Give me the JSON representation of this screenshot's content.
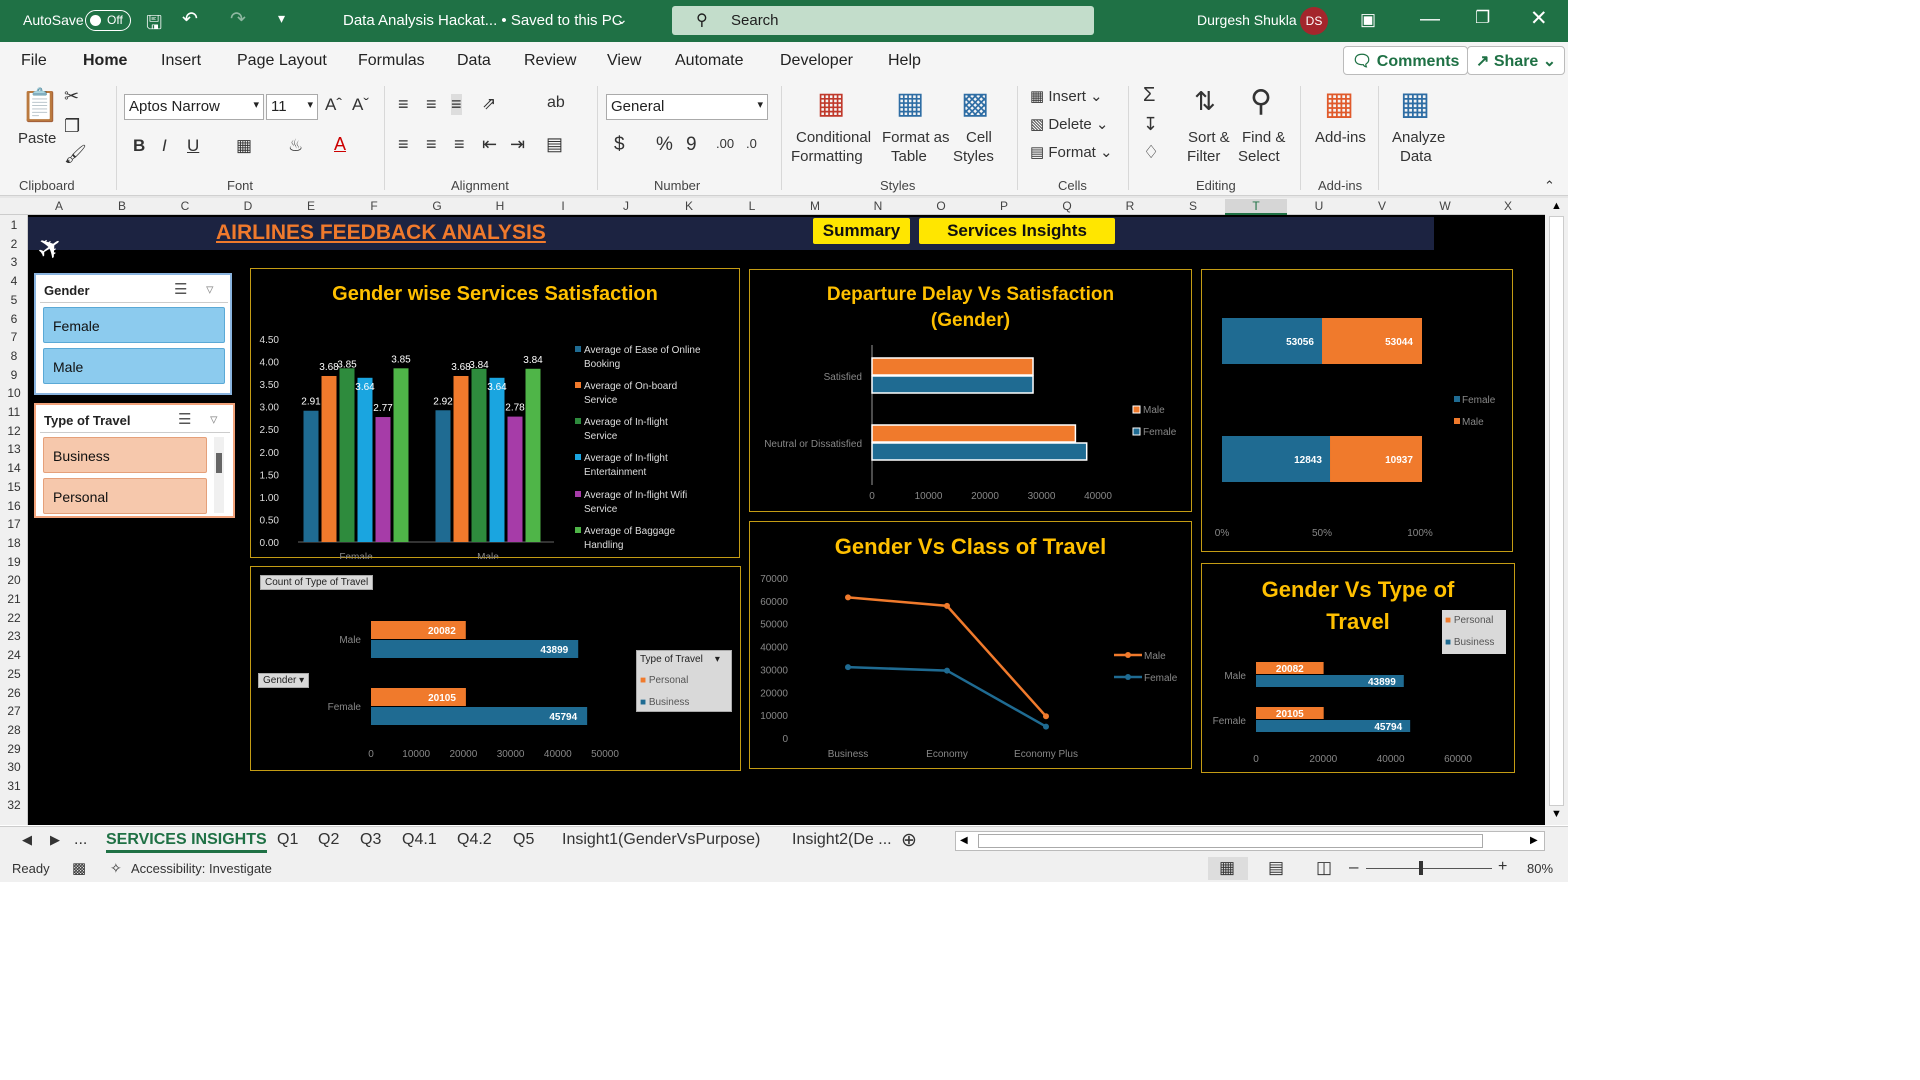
{
  "titlebar": {
    "autosave_label": "AutoSave",
    "autosave_state": "Off",
    "doc_title": "Data Analysis Hackat... • Saved to this PC",
    "search_placeholder": "Search",
    "user_name": "Durgesh Shukla",
    "user_initials": "DS"
  },
  "menu": {
    "items": [
      "File",
      "Home",
      "Insert",
      "Page Layout",
      "Formulas",
      "Data",
      "Review",
      "View",
      "Automate",
      "Developer",
      "Help"
    ],
    "active": "Home",
    "comments_label": "Comments",
    "share_label": "Share"
  },
  "ribbon": {
    "paste_label": "Paste",
    "font_name": "Aptos Narrow",
    "font_size": "11",
    "number_format": "General",
    "conditional_formatting": [
      "Conditional",
      "Formatting"
    ],
    "format_as_table": [
      "Format as",
      "Table"
    ],
    "cell_styles": [
      "Cell",
      "Styles"
    ],
    "insert_label": "Insert",
    "delete_label": "Delete",
    "format_label": "Format",
    "sort_filter": [
      "Sort &",
      "Filter"
    ],
    "find_select": [
      "Find &",
      "Select"
    ],
    "addins_label": "Add-ins",
    "analyze_data": [
      "Analyze",
      "Data"
    ],
    "groups": [
      "Clipboard",
      "Font",
      "Alignment",
      "Number",
      "Styles",
      "Cells",
      "Editing",
      "Add-ins"
    ]
  },
  "grid": {
    "columns": [
      "A",
      "B",
      "C",
      "D",
      "E",
      "F",
      "G",
      "H",
      "I",
      "J",
      "K",
      "L",
      "M",
      "N",
      "O",
      "P",
      "Q",
      "R",
      "S",
      "T",
      "U",
      "V",
      "W",
      "X"
    ],
    "rows": [
      "1",
      "2",
      "3",
      "4",
      "5",
      "6",
      "7",
      "8",
      "9",
      "10",
      "11",
      "12",
      "13",
      "14",
      "15",
      "16",
      "17",
      "18",
      "19",
      "20",
      "21",
      "22",
      "23",
      "24",
      "25",
      "26",
      "27",
      "28",
      "29",
      "30",
      "31",
      "32"
    ]
  },
  "dashboard": {
    "title": "AIRLINES FEEDBACK ANALYSIS",
    "summary_button": "Summary",
    "services_button": "Services Insights",
    "accent_color": "#ffc000",
    "orange": "#f07a2c",
    "blue": "#1f6b92"
  },
  "slicers": {
    "gender": {
      "title": "Gender",
      "items": [
        "Female",
        "Male"
      ]
    },
    "travel": {
      "title": "Type of Travel",
      "items": [
        "Business",
        "Personal"
      ]
    }
  },
  "chart_data": [
    {
      "type": "bar",
      "title": "Gender wise Services Satisfaction",
      "categories": [
        "Female",
        "Male"
      ],
      "ylim": [
        0,
        4.5
      ],
      "yticks": [
        "0.00",
        "0.50",
        "1.00",
        "1.50",
        "2.00",
        "2.50",
        "3.00",
        "3.50",
        "4.00",
        "4.50"
      ],
      "series": [
        {
          "name": "Average of Ease of Online Booking",
          "color": "#1f6b92",
          "values": [
            2.91,
            2.92
          ]
        },
        {
          "name": "Average of On-board Service",
          "color": "#f07a2c",
          "values": [
            3.68,
            3.68
          ]
        },
        {
          "name": "Average of In-flight Service",
          "color": "#2e8b3d",
          "values": [
            3.85,
            3.84
          ]
        },
        {
          "name": "Average of In-flight Entertainment",
          "color": "#1aa5e0",
          "values": [
            3.64,
            3.64
          ]
        },
        {
          "name": "Average of In-flight Wifi Service",
          "color": "#a63ca8",
          "values": [
            2.77,
            2.78
          ]
        },
        {
          "name": "Average of Baggage Handling",
          "color": "#4fb548",
          "values": [
            3.85,
            3.84
          ]
        }
      ],
      "legend": "right"
    },
    {
      "type": "bar",
      "orientation": "horizontal",
      "title": "Departure Delay Vs Satisfaction (Gender)",
      "categories": [
        "Satisfied",
        "Neutral or Dissatisfied"
      ],
      "xlim": [
        0,
        40000
      ],
      "xticks": [
        "0",
        "10000",
        "20000",
        "30000",
        "40000"
      ],
      "series": [
        {
          "name": "Male",
          "color": "#f07a2c",
          "values": [
            28500,
            36000
          ]
        },
        {
          "name": "Female",
          "color": "#1f6b92",
          "values": [
            28500,
            38000
          ]
        }
      ],
      "legend": "right"
    },
    {
      "type": "bar",
      "orientation": "horizontal",
      "stacked": "percent",
      "series": [
        {
          "name": "Female",
          "color": "#1f6b92",
          "values": [
            53056,
            12843
          ]
        },
        {
          "name": "Male",
          "color": "#f07a2c",
          "values": [
            53044,
            10937
          ]
        }
      ],
      "xticks": [
        "0%",
        "50%",
        "100%"
      ],
      "legend": "right"
    },
    {
      "type": "bar",
      "orientation": "horizontal",
      "pivot_field": "Count of Type of Travel",
      "row_field": "Gender",
      "legend_title": "Type of Travel",
      "categories": [
        "Male",
        "Female"
      ],
      "xlim": [
        0,
        50000
      ],
      "xticks": [
        "0",
        "10000",
        "20000",
        "30000",
        "40000",
        "50000"
      ],
      "series": [
        {
          "name": "Personal",
          "color": "#f07a2c",
          "values": [
            20082,
            20105
          ]
        },
        {
          "name": "Business",
          "color": "#1f6b92",
          "values": [
            43899,
            45794
          ]
        }
      ],
      "legend": "right"
    },
    {
      "type": "line",
      "title": "Gender Vs Class of Travel",
      "categories": [
        "Business",
        "Economy",
        "Economy Plus"
      ],
      "ylim": [
        0,
        70000
      ],
      "yticks": [
        "0",
        "10000",
        "20000",
        "30000",
        "40000",
        "50000",
        "60000",
        "70000"
      ],
      "series": [
        {
          "name": "Male",
          "color": "#f07a2c",
          "values": [
            61500,
            57800,
            9500
          ]
        },
        {
          "name": "Female",
          "color": "#1f6b92",
          "values": [
            31000,
            29500,
            5000
          ]
        }
      ],
      "legend": "right"
    },
    {
      "type": "bar",
      "orientation": "horizontal",
      "title": "Gender Vs Type of Travel",
      "categories": [
        "Male",
        "Female"
      ],
      "xlim": [
        0,
        60000
      ],
      "xticks": [
        "0",
        "20000",
        "40000",
        "60000"
      ],
      "series": [
        {
          "name": "Personal",
          "color": "#f07a2c",
          "values": [
            20082,
            20105
          ]
        },
        {
          "name": "Business",
          "color": "#1f6b92",
          "values": [
            43899,
            45794
          ]
        }
      ],
      "legend": "top-right"
    }
  ],
  "tabs": {
    "items": [
      "SERVICES INSIGHTS",
      "Q1",
      "Q2",
      "Q3",
      "Q4.1",
      "Q4.2",
      "Q5",
      "Insight1(GenderVsPurpose)",
      "Insight2(De ..."
    ],
    "active": "SERVICES INSIGHTS"
  },
  "status": {
    "ready": "Ready",
    "accessibility": "Accessibility: Investigate",
    "zoom": "80%"
  }
}
